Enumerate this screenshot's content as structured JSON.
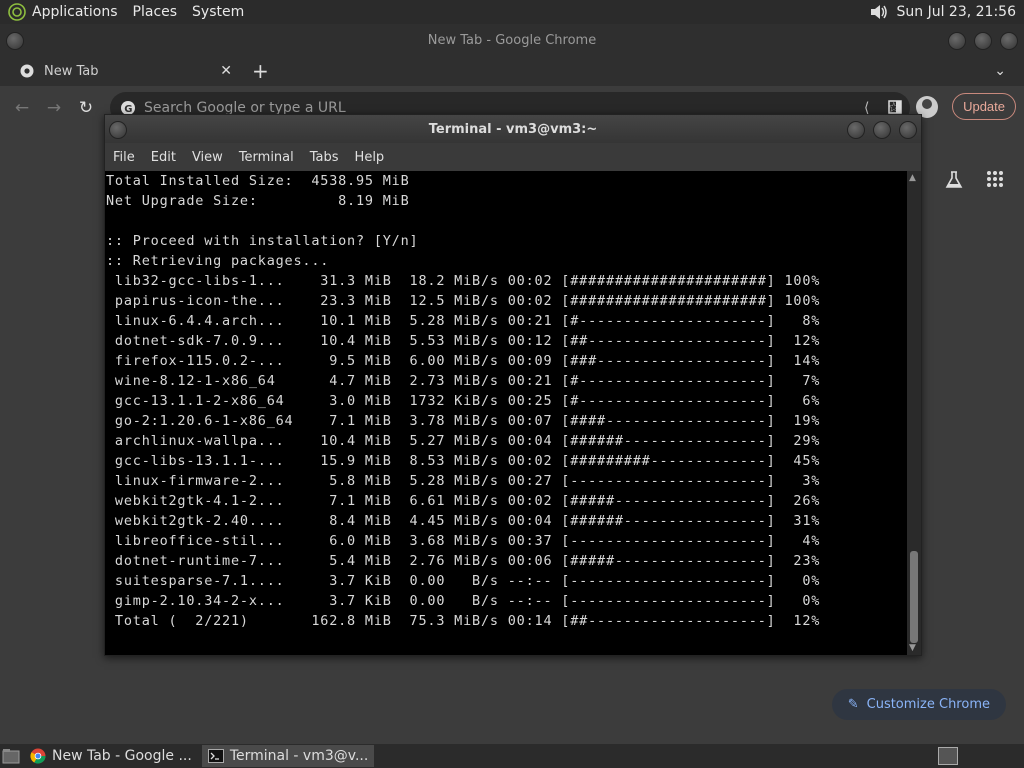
{
  "top_panel": {
    "menus": [
      "Applications",
      "Places",
      "System"
    ],
    "datetime": "Sun Jul 23, 21:56"
  },
  "chrome": {
    "window_title": "New Tab - Google Chrome",
    "tab_title": "New Tab",
    "omnibox_placeholder": "Search Google or type a URL",
    "update_label": "Update",
    "customize_label": "Customize Chrome"
  },
  "terminal": {
    "window_title": "Terminal - vm3@vm3:~",
    "menus": [
      "File",
      "Edit",
      "View",
      "Terminal",
      "Tabs",
      "Help"
    ],
    "lines": [
      "Total Installed Size:  4538.95 MiB",
      "Net Upgrade Size:         8.19 MiB",
      "",
      ":: Proceed with installation? [Y/n]",
      ":: Retrieving packages...",
      " lib32-gcc-libs-1...    31.3 MiB  18.2 MiB/s 00:02 [######################] 100%",
      " papirus-icon-the...    23.3 MiB  12.5 MiB/s 00:02 [######################] 100%",
      " linux-6.4.4.arch...    10.1 MiB  5.28 MiB/s 00:21 [#---------------------]   8%",
      " dotnet-sdk-7.0.9...    10.4 MiB  5.53 MiB/s 00:12 [##--------------------]  12%",
      " firefox-115.0.2-...     9.5 MiB  6.00 MiB/s 00:09 [###-------------------]  14%",
      " wine-8.12-1-x86_64      4.7 MiB  2.73 MiB/s 00:21 [#---------------------]   7%",
      " gcc-13.1.1-2-x86_64     3.0 MiB  1732 KiB/s 00:25 [#---------------------]   6%",
      " go-2:1.20.6-1-x86_64    7.1 MiB  3.78 MiB/s 00:07 [####------------------]  19%",
      " archlinux-wallpa...    10.4 MiB  5.27 MiB/s 00:04 [######----------------]  29%",
      " gcc-libs-13.1.1-...    15.9 MiB  8.53 MiB/s 00:02 [#########-------------]  45%",
      " linux-firmware-2...     5.8 MiB  5.28 MiB/s 00:27 [----------------------]   3%",
      " webkit2gtk-4.1-2...     7.1 MiB  6.61 MiB/s 00:02 [#####-----------------]  26%",
      " webkit2gtk-2.40....     8.4 MiB  4.45 MiB/s 00:04 [######----------------]  31%",
      " libreoffice-stil...     6.0 MiB  3.68 MiB/s 00:37 [----------------------]   4%",
      " dotnet-runtime-7...     5.4 MiB  2.76 MiB/s 00:06 [#####-----------------]  23%",
      " suitesparse-7.1....     3.7 KiB  0.00   B/s --:-- [----------------------]   0%",
      " gimp-2.10.34-2-x...     3.7 KiB  0.00   B/s --:-- [----------------------]   0%",
      " Total (  2/221)       162.8 MiB  75.3 MiB/s 00:14 [##--------------------]  12%"
    ]
  },
  "taskbar": {
    "items": [
      "New Tab - Google ...",
      "Terminal - vm3@v..."
    ]
  }
}
